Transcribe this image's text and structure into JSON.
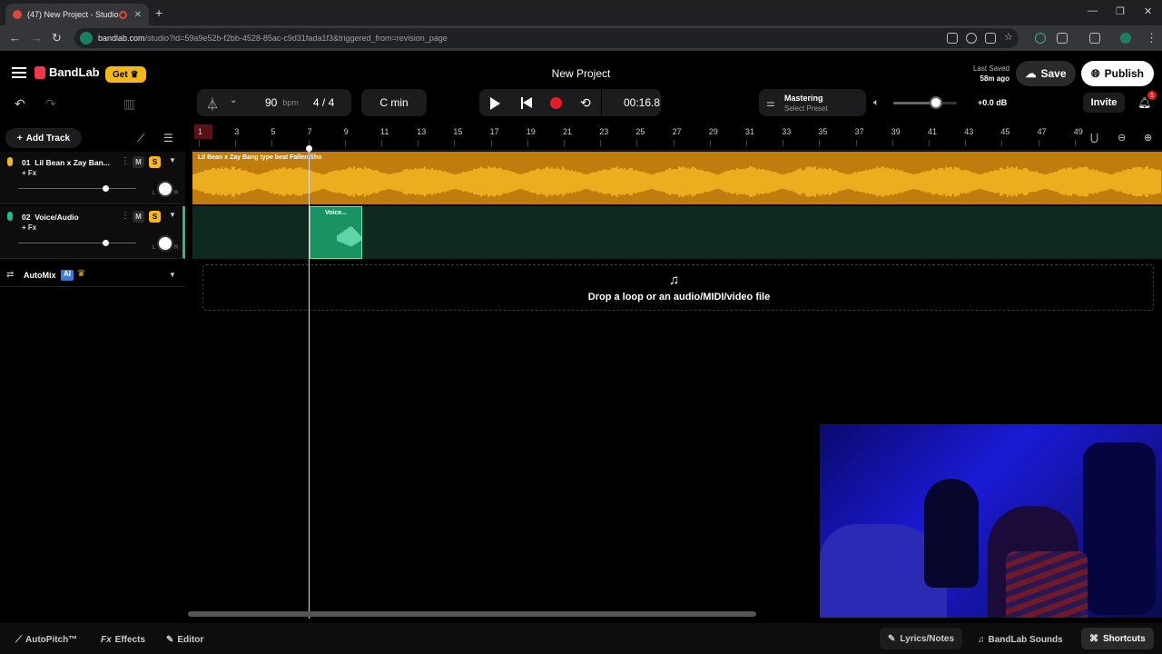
{
  "browser": {
    "tab_title": "(47) New Project - Studio",
    "url_host": "bandlab.com",
    "url_path": "/studio?id=59a9e52b-f2bb-4528-85ac-c9d31fada1f3&triggered_from=revision_page"
  },
  "header": {
    "logo": "BandLab",
    "get_label": "Get",
    "project_title": "New Project",
    "last_saved_label": "Last Saved",
    "last_saved_time": "58m ago",
    "save_label": "Save",
    "publish_label": "Publish"
  },
  "toolbar": {
    "tempo": "90",
    "tempo_unit": "bpm",
    "time_sig_num": "4",
    "time_sig_sep": "/",
    "time_sig_den": "4",
    "key": "C min",
    "time": "00:16.8",
    "mastering_label": "Mastering",
    "mastering_preset": "Select Preset",
    "volume_level": 0.65,
    "db": "+0.0 dB",
    "invite_label": "Invite",
    "notif_count": "1"
  },
  "sidebar": {
    "add_track_label": "Add Track",
    "tracks": [
      {
        "num": "01",
        "name": "Lil Bean x Zay Ban...",
        "fx": "+ Fx",
        "color": "#f5b81a"
      },
      {
        "num": "02",
        "name": "Voice/Audio",
        "fx": "+ Fx",
        "color": "#1fbe8a"
      }
    ],
    "mute": "M",
    "solo": "S",
    "pan_l": "L",
    "pan_r": "R",
    "automix_label": "AutoMix",
    "ai_badge": "AI"
  },
  "timeline": {
    "bars": [
      "1",
      "3",
      "5",
      "7",
      "9",
      "11",
      "13",
      "15",
      "17",
      "19",
      "21",
      "23",
      "25",
      "27",
      "29",
      "31",
      "33",
      "35",
      "37",
      "39",
      "41",
      "43",
      "45",
      "47",
      "49"
    ],
    "clip1_label": "Lil Bean x Zay Bang type beat Fallen Sho",
    "clip2_label": "Voice...",
    "drop_text": "Drop a loop or an audio/MIDI/video file"
  },
  "bottombar": {
    "autopitch": "AutoPitch™",
    "effects": "Effects",
    "editor": "Editor",
    "lyrics": "Lyrics/Notes",
    "sounds": "BandLab Sounds",
    "shortcuts": "Shortcuts"
  }
}
